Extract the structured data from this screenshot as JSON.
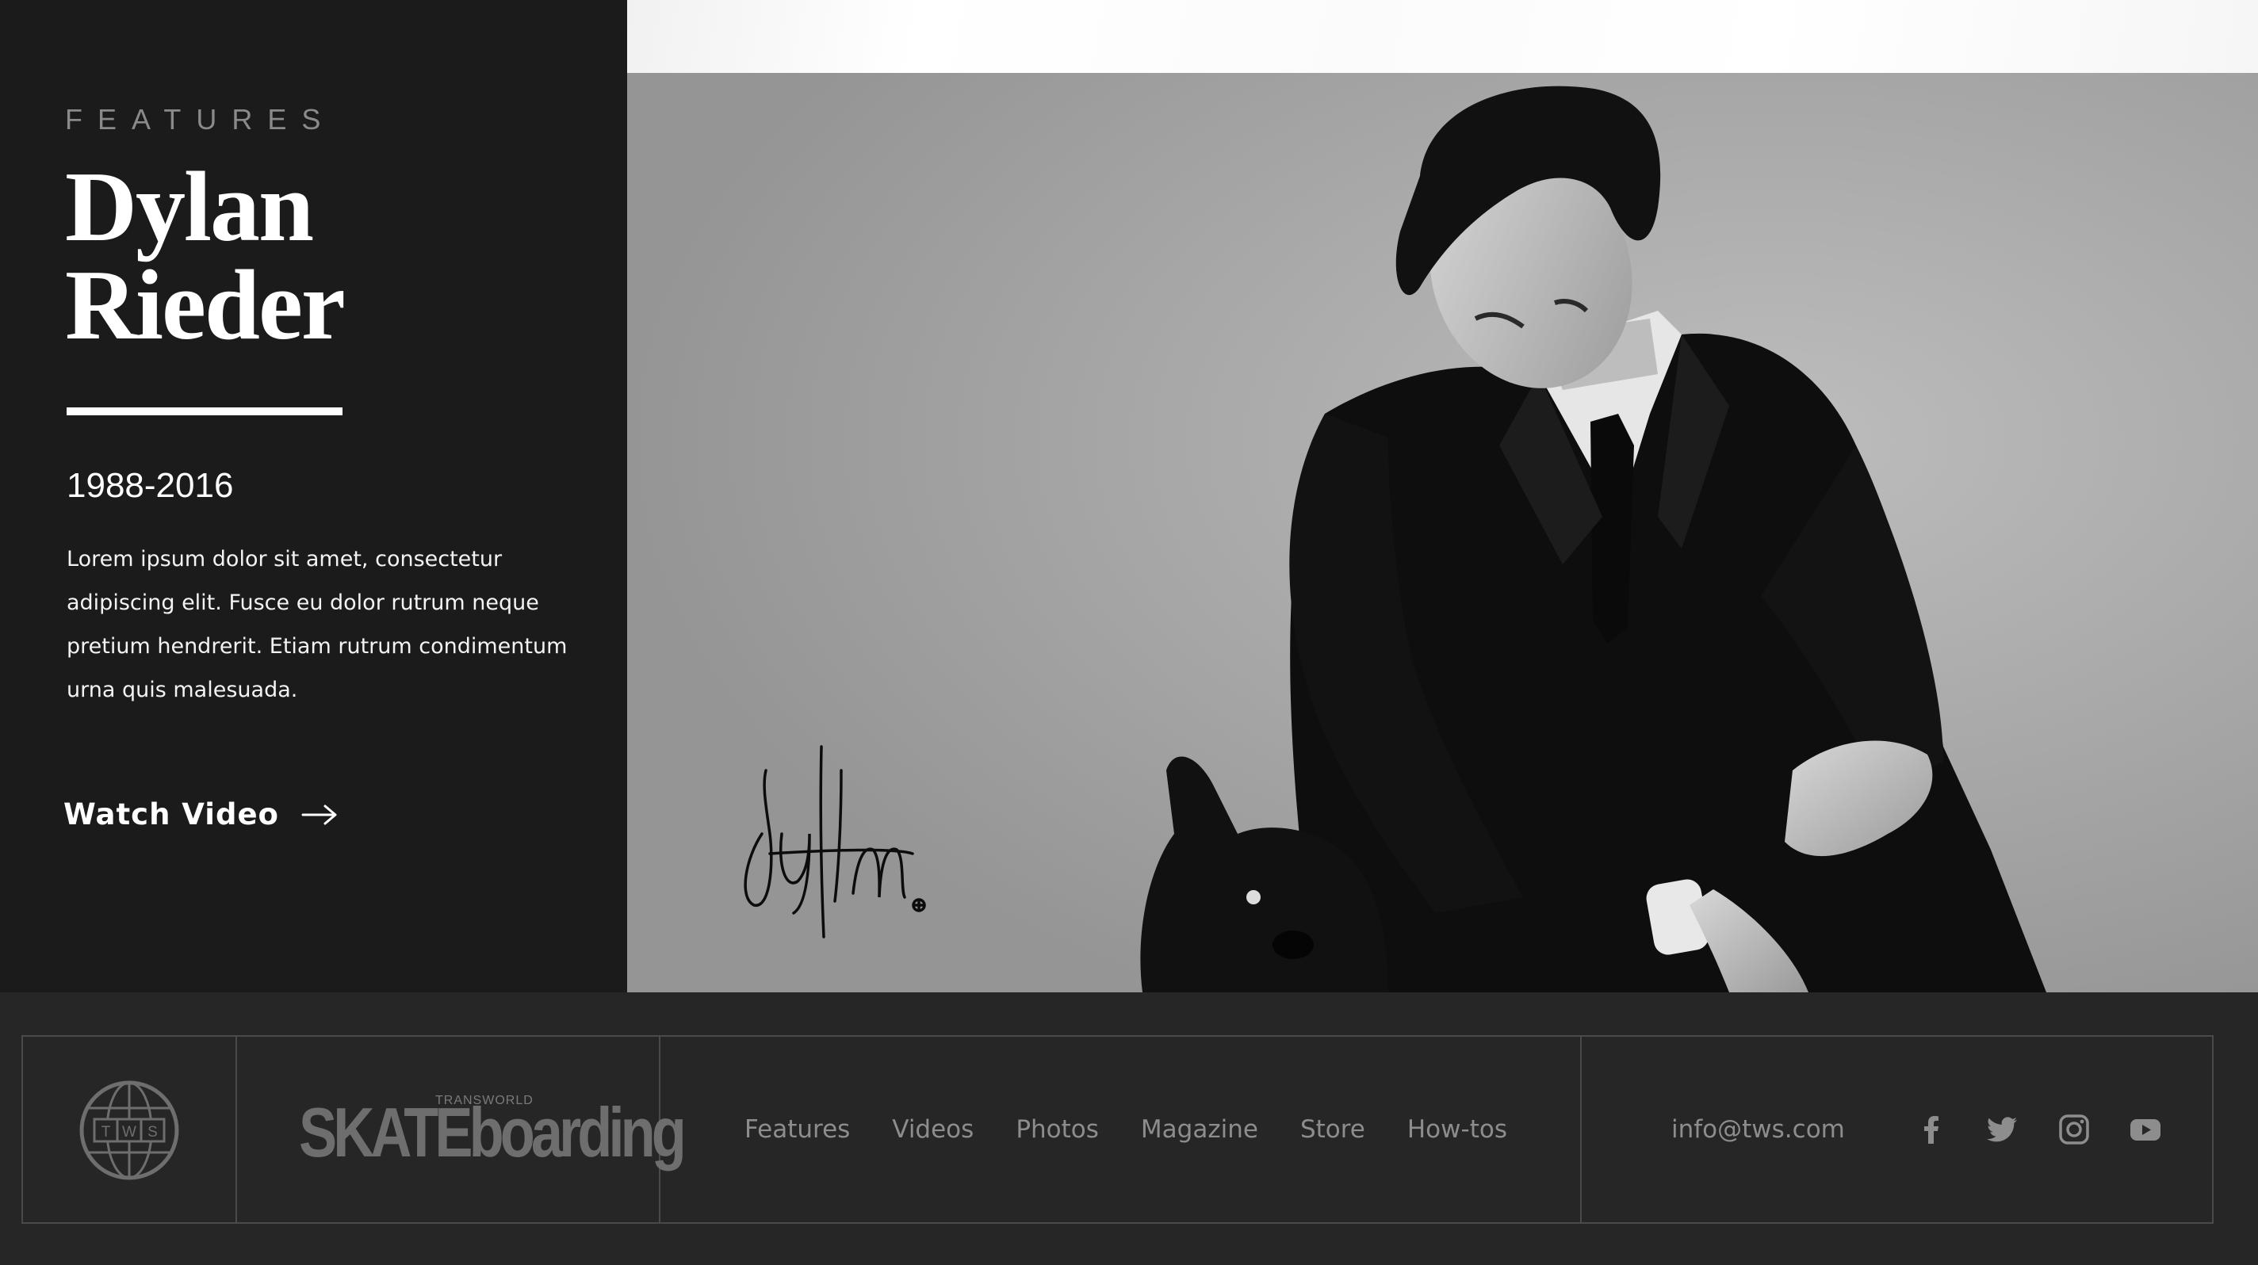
{
  "feature": {
    "eyebrow": "FEATURES",
    "name_line1": "Dylan",
    "name_line2": "Rieder",
    "years": "1988-2016",
    "body": "Lorem ipsum dolor sit amet, consectetur adipiscing elit. Fusce eu dolor rutrum neque pretium hendrerit. Etiam rutrum condimentum urna quis malesuada.",
    "watch_label": "Watch Video",
    "signature_text": "dylan"
  },
  "footer": {
    "logo_letters": [
      "T",
      "W",
      "S"
    ],
    "brand_small": "TRANSWORLD",
    "brand_main": "SKATEboarding",
    "nav": [
      "Features",
      "Videos",
      "Photos",
      "Magazine",
      "Store",
      "How-tos"
    ],
    "email": "info@tws.com",
    "social_icons": [
      "facebook-icon",
      "twitter-icon",
      "instagram-icon",
      "youtube-icon"
    ]
  },
  "colors": {
    "panel_bg": "#1b1b1c",
    "footer_bg": "#262626",
    "footer_text": "#8d8d8d",
    "accent_white": "#ffffff"
  }
}
